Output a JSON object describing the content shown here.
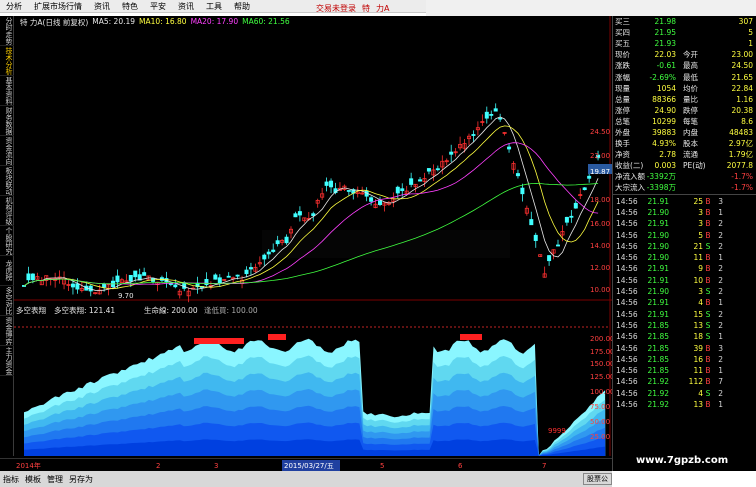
{
  "menubar": [
    "分析",
    "扩展市场行情",
    "资讯",
    "特色",
    "平安",
    "资讯",
    "工具",
    "帮助"
  ],
  "topright": {
    "items": [
      "交易未登录",
      "特",
      "力A"
    ]
  },
  "leftbar": {
    "items": [
      "分时走势",
      "技术分析",
      "基本资料",
      "财务数据",
      "资金流向",
      "板块联动",
      "机构评级",
      "个股研究",
      "龙虎榜",
      "多空对比",
      "资金博弈",
      "主力资金"
    ],
    "active": 1
  },
  "chart_header": {
    "name": "特 力A(日线 前复权)",
    "ma5": "MA5: 20.19",
    "ma10": "MA10: 16.80",
    "ma20": "MA20: 17.90",
    "ma60": "MA60: 21.56"
  },
  "price_axis": [
    "24.50",
    "22.00",
    "19.87",
    "18.00",
    "16.00",
    "14.00",
    "12.00",
    "10.00"
  ],
  "last_price_tag": "19.87",
  "low_label": "9.70",
  "indicator_header": {
    "name": "多空表翔",
    "sub": "多空表翔: 121.41",
    "s1": "生命線: 200.00",
    "s2": "逢低買: 100.00"
  },
  "indicator_axis": [
    "200.00",
    "175.00",
    "150.00",
    "125.00",
    "100.00",
    "75.00",
    "50.00",
    "25.00"
  ],
  "indicator_label": "9999",
  "date_axis": {
    "left": "2014年",
    "items": [
      "2",
      "3",
      "2015/03/27/五",
      "5",
      "6",
      "7"
    ]
  },
  "bottombar": [
    "指标",
    "模板",
    "管理",
    "另存为"
  ],
  "quote": {
    "rows": [
      {
        "c1": "买三",
        "c2": "21.98",
        "c3": "",
        "c4": "307"
      },
      {
        "c1": "买四",
        "c2": "21.95",
        "c3": "",
        "c4": "5"
      },
      {
        "c1": "买五",
        "c2": "21.93",
        "c3": "",
        "c4": "1"
      },
      {
        "c1": "现价",
        "c2": "22.03",
        "c3": "今开",
        "c4": "23.00"
      },
      {
        "c1": "涨跌",
        "c2": "-0.61",
        "c3": "最高",
        "c4": "24.50"
      },
      {
        "c1": "涨幅",
        "c2": "-2.69%",
        "c3": "最低",
        "c4": "21.65"
      },
      {
        "c1": "现量",
        "c2": "1054",
        "c3": "均价",
        "c4": "22.84"
      },
      {
        "c1": "总量",
        "c2": "88366",
        "c3": "量比",
        "c4": "1.16"
      },
      {
        "c1": "涨停",
        "c2": "24.90",
        "c3": "跌停",
        "c4": "20.38"
      },
      {
        "c1": "总笔",
        "c2": "10299",
        "c3": "每笔",
        "c4": "8.6"
      },
      {
        "c1": "外盘",
        "c2": "39883",
        "c3": "内盘",
        "c4": "48483"
      },
      {
        "c1": "换手",
        "c2": "4.93%",
        "c3": "股本",
        "c4": "2.97亿"
      },
      {
        "c1": "净资",
        "c2": "2.78",
        "c3": "流通",
        "c4": "1.79亿"
      },
      {
        "c1": "收益(二)",
        "c2": "0.003",
        "c3": "PE(动)",
        "c4": "2077.8"
      },
      {
        "c1": "净流入额",
        "c2": "-3392万",
        "c3": "",
        "c4": "-1.7%"
      },
      {
        "c1": "大宗流入",
        "c2": "-3398万",
        "c3": "",
        "c4": "-1.7%"
      }
    ]
  },
  "ticks": [
    {
      "t": "14:56",
      "p": "21.91",
      "v": "25",
      "s": "B",
      "n": "3"
    },
    {
      "t": "14:56",
      "p": "21.90",
      "v": "3",
      "s": "B",
      "n": "1"
    },
    {
      "t": "14:56",
      "p": "21.91",
      "v": "3",
      "s": "B",
      "n": "2"
    },
    {
      "t": "14:56",
      "p": "21.90",
      "v": "5",
      "s": "B",
      "n": "2"
    },
    {
      "t": "14:56",
      "p": "21.90",
      "v": "21",
      "s": "S",
      "n": "2"
    },
    {
      "t": "14:56",
      "p": "21.90",
      "v": "11",
      "s": "B",
      "n": "1"
    },
    {
      "t": "14:56",
      "p": "21.91",
      "v": "9",
      "s": "B",
      "n": "2"
    },
    {
      "t": "14:56",
      "p": "21.91",
      "v": "10",
      "s": "B",
      "n": "2"
    },
    {
      "t": "14:56",
      "p": "21.90",
      "v": "3",
      "s": "S",
      "n": "2"
    },
    {
      "t": "14:56",
      "p": "21.91",
      "v": "4",
      "s": "B",
      "n": "1"
    },
    {
      "t": "14:56",
      "p": "21.91",
      "v": "15",
      "s": "S",
      "n": "2"
    },
    {
      "t": "14:56",
      "p": "21.85",
      "v": "13",
      "s": "S",
      "n": "2"
    },
    {
      "t": "14:56",
      "p": "21.85",
      "v": "18",
      "s": "S",
      "n": "1"
    },
    {
      "t": "14:56",
      "p": "21.85",
      "v": "39",
      "s": "B",
      "n": "3"
    },
    {
      "t": "14:56",
      "p": "21.85",
      "v": "16",
      "s": "B",
      "n": "2"
    },
    {
      "t": "14:56",
      "p": "21.85",
      "v": "11",
      "s": "B",
      "n": "1"
    },
    {
      "t": "14:56",
      "p": "21.92",
      "v": "112",
      "s": "B",
      "n": "7"
    },
    {
      "t": "14:56",
      "p": "21.92",
      "v": "4",
      "s": "S",
      "n": "2"
    },
    {
      "t": "14:56",
      "p": "21.92",
      "v": "13",
      "s": "B",
      "n": "1"
    }
  ],
  "corner_label": "股票公",
  "watermark": "www.7gpzb.com"
}
